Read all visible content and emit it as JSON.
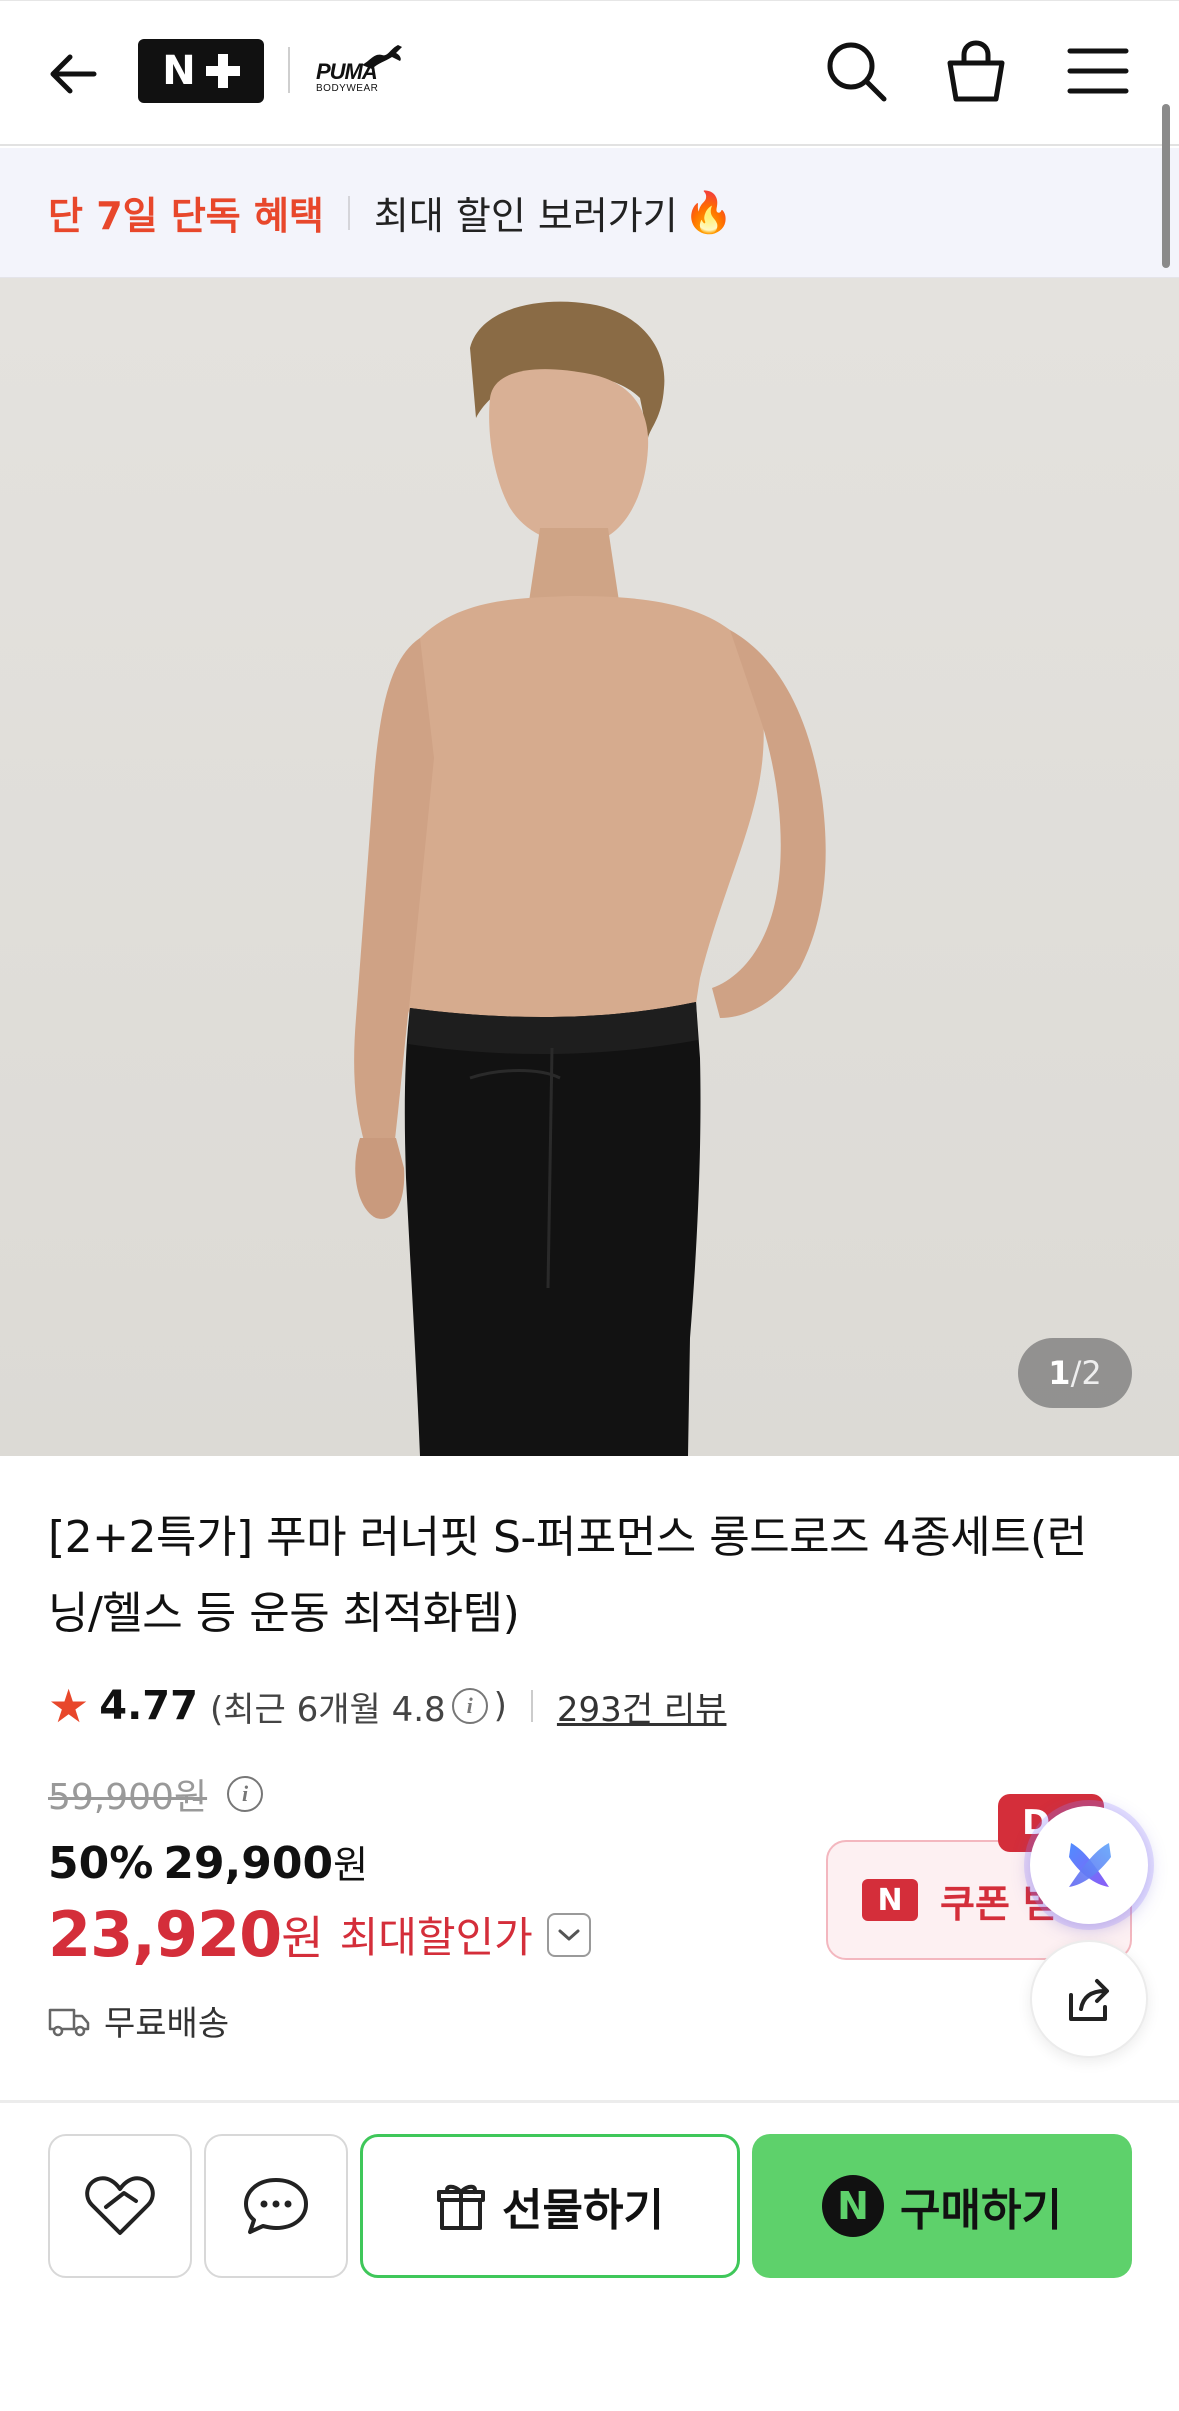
{
  "header": {
    "brand_plus": "N",
    "brand_logo_word": "PUMA",
    "brand_logo_sub": "BODYWEAR"
  },
  "promo": {
    "highlight": "단 7일 단독 혜택",
    "link": "최대 할인 보러가기",
    "fire": "🔥"
  },
  "gallery": {
    "current": "1",
    "separator": "/",
    "total": "2"
  },
  "product": {
    "title": "[2+2특가] 푸마 러너핏 S-퍼포먼스 롱드로즈 4종세트(런닝/헬스 등 운동 최적화템)",
    "rating_score": "4.77",
    "recent_rating_prefix": "(최근 6개월 4.8",
    "recent_rating_suffix": ")",
    "info_glyph": "i",
    "review_count_link": "293건 리뷰",
    "original_price": "59,900원",
    "discount_percent": "50%",
    "sale_price_number": "29,900",
    "sale_price_unit": "원",
    "max_price_number": "23,920",
    "max_price_unit": "원",
    "max_price_label": "최대할인가",
    "shipping": "무료배송"
  },
  "coupon": {
    "label": "쿠폰 받",
    "mark": "N",
    "badge": "D"
  },
  "actions": {
    "gift_label": "선물하기",
    "buy_label": "구매하기",
    "buy_mark": "N"
  },
  "colors": {
    "accent_red": "#d42e3a",
    "promo_orange": "#e8472b",
    "buy_green": "#5ed16b",
    "gift_border": "#3fc75a"
  }
}
